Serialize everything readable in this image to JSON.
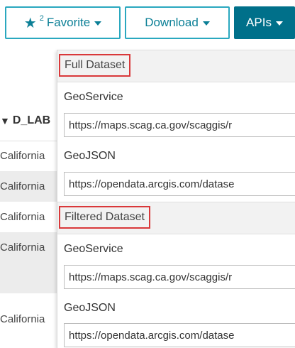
{
  "toolbar": {
    "favorite_label": "Favorite",
    "favorite_count": "2",
    "download_label": "Download",
    "apis_label": "APIs"
  },
  "table": {
    "header": "D_LAB",
    "rows": [
      "California",
      "California",
      "California",
      "California",
      "California"
    ]
  },
  "apis_menu": {
    "full_dataset": {
      "title": "Full Dataset",
      "geoservice_label": "GeoService",
      "geoservice_url": "https://maps.scag.ca.gov/scaggis/r",
      "geojson_label": "GeoJSON",
      "geojson_url": "https://opendata.arcgis.com/datase"
    },
    "filtered_dataset": {
      "title": "Filtered Dataset",
      "geoservice_label": "GeoService",
      "geoservice_url": "https://maps.scag.ca.gov/scaggis/r",
      "geojson_label": "GeoJSON",
      "geojson_url": "https://opendata.arcgis.com/datase"
    }
  },
  "colors": {
    "accent": "#00708a",
    "outline": "#2aa8bf",
    "highlight": "#d9383a"
  }
}
